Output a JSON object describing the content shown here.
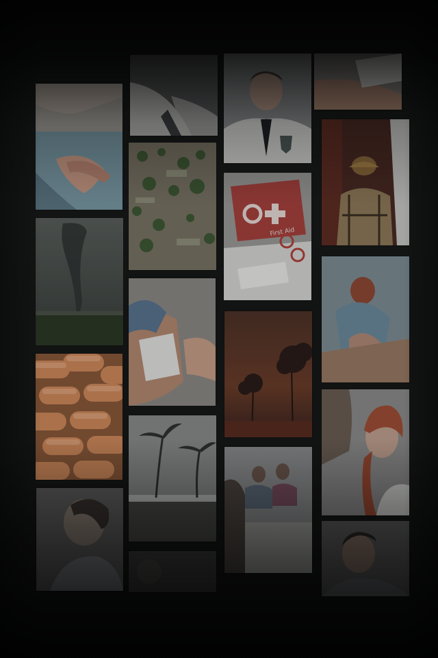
{
  "screen": {
    "background_color": "#0b0c0c"
  },
  "collage": {
    "tiles": [
      {
        "subject": "cpr-hands",
        "icon": "hands-compression-icon"
      },
      {
        "subject": "tornado",
        "icon": "tornado-icon"
      },
      {
        "subject": "pills",
        "icon": "pill-icon"
      },
      {
        "subject": "person-profile",
        "icon": "person-icon"
      },
      {
        "subject": "doctor-coat-top",
        "icon": "coat-icon"
      },
      {
        "subject": "flood-aerial",
        "icon": "flood-icon"
      },
      {
        "subject": "bandaging-arm",
        "icon": "bandage-icon"
      },
      {
        "subject": "hurricane-palms",
        "icon": "storm-icon"
      },
      {
        "subject": "partial-dark",
        "icon": "photo-icon"
      },
      {
        "subject": "doctor-portrait",
        "icon": "doctor-icon"
      },
      {
        "subject": "first-aid-kit",
        "icon": "first-aid-kit-icon",
        "label": "First Aid"
      },
      {
        "subject": "wildfire",
        "icon": "fire-icon"
      },
      {
        "subject": "group-lesson",
        "icon": "group-icon"
      },
      {
        "subject": "bandage-top",
        "icon": "bandage-icon"
      },
      {
        "subject": "firefighter",
        "icon": "firefighter-icon"
      },
      {
        "subject": "cpr-training",
        "icon": "cpr-icon"
      },
      {
        "subject": "woman-portrait",
        "icon": "woman-icon"
      },
      {
        "subject": "man-portrait",
        "icon": "man-icon"
      }
    ]
  }
}
